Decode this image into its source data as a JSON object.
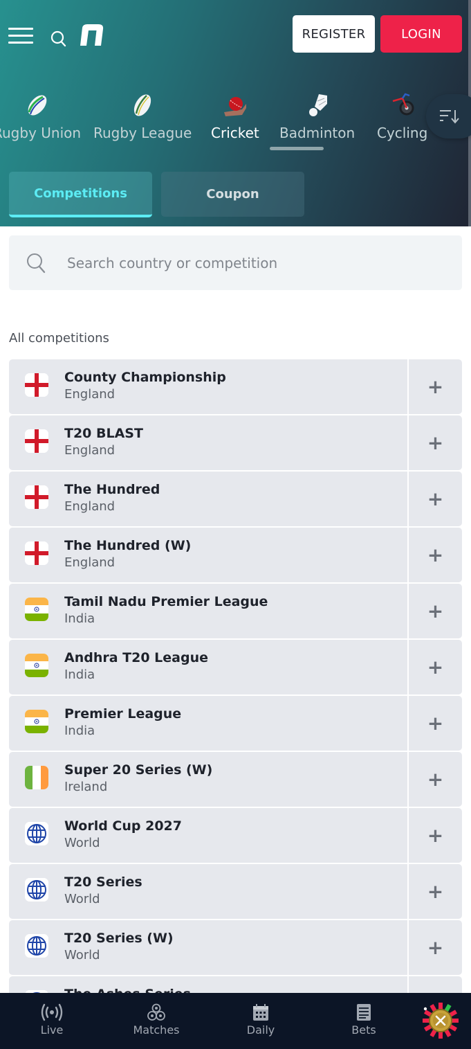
{
  "header": {
    "menu_icon": "hamburger-icon",
    "search_icon": "search-icon",
    "logo": "brand-logo",
    "register_label": "REGISTER",
    "login_label": "LOGIN",
    "colors": {
      "login": "#ee2249",
      "accent": "#5cecf4"
    }
  },
  "sports": [
    {
      "label": "Rugby Union",
      "icon": "rugby-union-ball-icon",
      "active": false
    },
    {
      "label": "Rugby League",
      "icon": "rugby-league-ball-icon",
      "active": false
    },
    {
      "label": "Cricket",
      "icon": "cricket-icon",
      "active": true
    },
    {
      "label": "Badminton",
      "icon": "shuttlecock-icon",
      "active": false
    },
    {
      "label": "Cycling",
      "icon": "bicycle-icon",
      "active": false
    }
  ],
  "sort_icon": "sort-icon",
  "tabs": [
    {
      "label": "Competitions",
      "active": true
    },
    {
      "label": "Coupon",
      "active": false
    }
  ],
  "search": {
    "placeholder": "Search country or competition",
    "value": ""
  },
  "section_title": "All competitions",
  "competitions": [
    {
      "name": "County Championship",
      "country": "England",
      "flag": "england"
    },
    {
      "name": "T20 BLAST",
      "country": "England",
      "flag": "england"
    },
    {
      "name": "The Hundred",
      "country": "England",
      "flag": "england"
    },
    {
      "name": "The Hundred (W)",
      "country": "England",
      "flag": "england"
    },
    {
      "name": "Tamil Nadu Premier League",
      "country": "India",
      "flag": "india"
    },
    {
      "name": "Andhra T20 League",
      "country": "India",
      "flag": "india"
    },
    {
      "name": "Premier League",
      "country": "India",
      "flag": "india"
    },
    {
      "name": "Super 20 Series (W)",
      "country": "Ireland",
      "flag": "ireland"
    },
    {
      "name": "World Cup 2027",
      "country": "World",
      "flag": "world"
    },
    {
      "name": "T20 Series",
      "country": "World",
      "flag": "world"
    },
    {
      "name": "T20 Series (W)",
      "country": "World",
      "flag": "world"
    },
    {
      "name": "The Ashes Series",
      "country": "",
      "flag": "world"
    }
  ],
  "expand_symbol": "+",
  "bottom_nav": [
    {
      "label": "Live",
      "icon": "live-broadcast-icon"
    },
    {
      "label": "Matches",
      "icon": "matches-balls-icon"
    },
    {
      "label": "Daily",
      "icon": "calendar-icon"
    },
    {
      "label": "Bets",
      "icon": "bet-slip-icon"
    }
  ],
  "casino_icon": "roulette-icon"
}
